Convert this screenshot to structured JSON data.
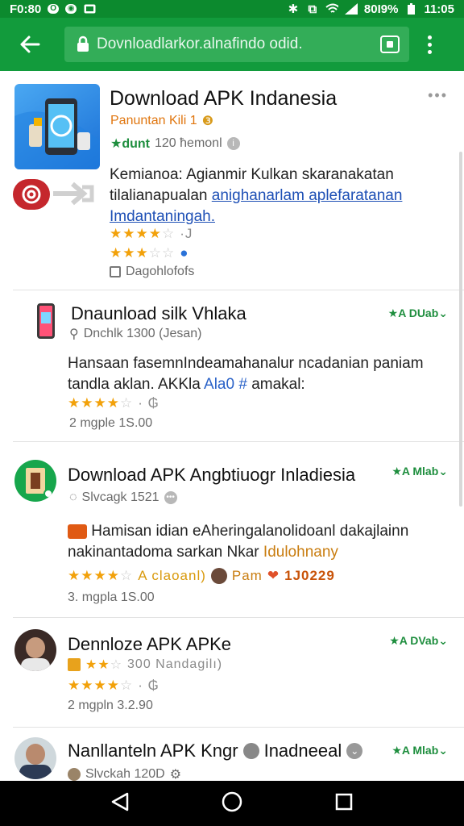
{
  "status_bar": {
    "time_left": "F0:80",
    "battery": "80I9%",
    "time_right": "11:05"
  },
  "toolbar": {
    "url": "Dovnloadlarkor.alnafindo odid."
  },
  "featured": {
    "title": "Download APK Indanesia",
    "developer": "Panuntan Kili 1",
    "downloads_prefix": "★dunt",
    "downloads": "120 ħemonl",
    "description_plain": "Kemianoa: Agianmir Kulkan skaranakatan tilalianapualan",
    "description_link": "anighanarlam aplefaratanan Imdantaningah.",
    "rating_badge": "·J",
    "category": "Dagohlofofs"
  },
  "items": [
    {
      "title": "Dnaunload silk Vhlaka",
      "tag": "★A DUab⌄",
      "meta": "Dnchlk 1300 (Jesan)",
      "description": "Hansaan fasemnIndeamahanalur ncadanian paniam tandla aklan. AKKla",
      "description_link": "Ala0 #",
      "description_tail": "amakal:",
      "rating_text": "",
      "footer": "2  mgple  1S.00"
    },
    {
      "title": "Download APK Angbtiuogr Inladiesia",
      "tag": "★A Mlab⌄",
      "meta": "Slvcagk 1521",
      "description": "Hamisan idian eAheringalanolidoanl dakajlainn nakinantadoma sarkan Nkar",
      "description_link": "Idulohnany",
      "rating_text": "A claoanl)",
      "badge_text": "Pam",
      "badge_code": "1J0229",
      "footer": "3.  mgpla  1S.00"
    },
    {
      "title": "Dennloze APK APKe",
      "tag": "★A DVab⌄",
      "meta": "300 Nandagilı)",
      "footer": "2  mgpln  3.2.90"
    },
    {
      "title": "Nanllanteln APK Kngr",
      "title_tail": "Inadneeal",
      "tag": "★A Mlab⌄",
      "meta": "Slvckah 120D"
    }
  ],
  "colors": {
    "toolbar": "#129b3c",
    "statusbar": "#0c8a2e",
    "star": "#f2a10a",
    "link": "#1d4fb5"
  }
}
